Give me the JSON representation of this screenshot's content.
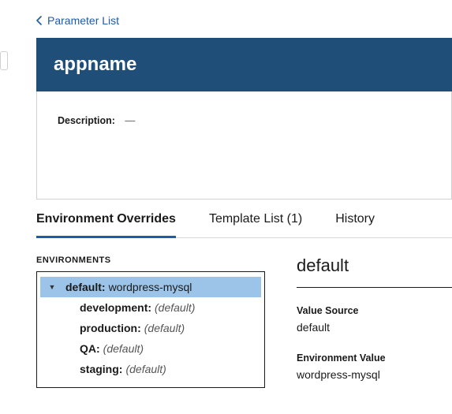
{
  "back_link": "Parameter List",
  "header_title": "appname",
  "description_label": "Description:",
  "description_value": "—",
  "tabs": [
    {
      "label": "Environment Overrides",
      "active": true
    },
    {
      "label": "Template List (1)",
      "active": false
    },
    {
      "label": "History",
      "active": false
    }
  ],
  "environments_heading": "ENVIRONMENTS",
  "env_tree": {
    "root": {
      "label": "default:",
      "value": "wordpress-mysql"
    },
    "children": [
      {
        "label": "development:",
        "value": "(default)"
      },
      {
        "label": "production:",
        "value": "(default)"
      },
      {
        "label": "QA:",
        "value": "(default)"
      },
      {
        "label": "staging:",
        "value": "(default)"
      }
    ]
  },
  "detail": {
    "title": "default",
    "value_source_label": "Value Source",
    "value_source": "default",
    "env_value_label": "Environment Value",
    "env_value": "wordpress-mysql"
  }
}
